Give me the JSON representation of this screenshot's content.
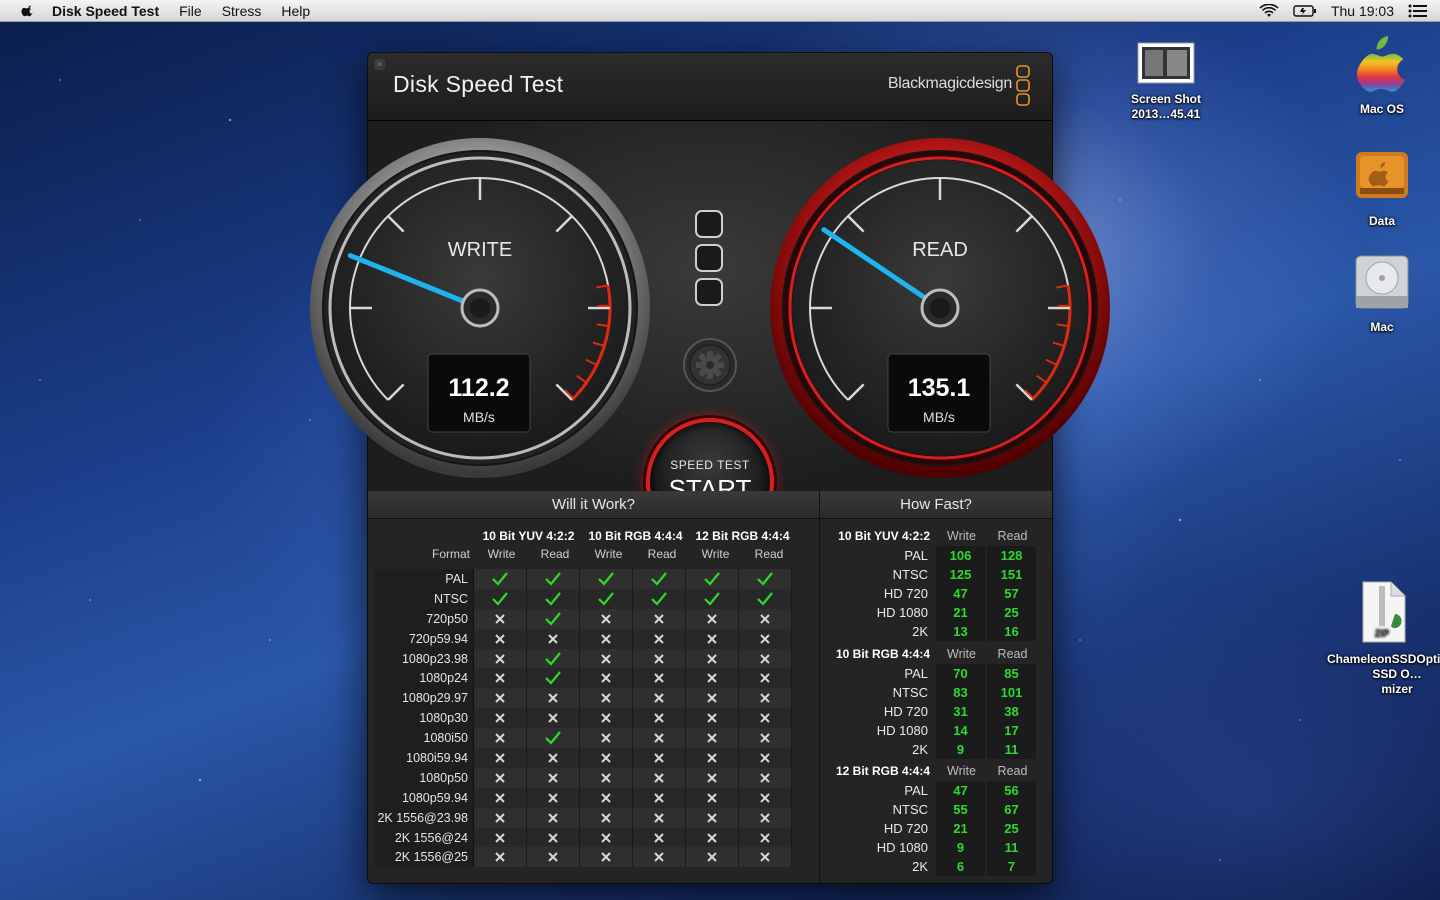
{
  "menubar": {
    "app_name": "Disk Speed Test",
    "menus": [
      "File",
      "Stress",
      "Help"
    ],
    "clock": "Thu 19:03"
  },
  "desktop_icons": [
    {
      "label": "Screen Shot 2013…45.41",
      "icon": "screenshot-file-icon"
    },
    {
      "label": "Mac OS",
      "icon": "apple-logo-drive-icon"
    },
    {
      "label": "Data",
      "icon": "external-drive-icon"
    },
    {
      "label": "Mac",
      "icon": "hard-drive-icon"
    },
    {
      "label": "ChameleonSSDOptimizer.zip",
      "overlap_label": "SSD O…mizer",
      "icon": "zip-file-icon"
    }
  ],
  "window": {
    "title": "Disk Speed Test",
    "brand": "Blackmagicdesign"
  },
  "gauges": {
    "write": {
      "label": "WRITE",
      "value": "112.2",
      "unit": "MB/s"
    },
    "read": {
      "label": "READ",
      "value": "135.1",
      "unit": "MB/s"
    }
  },
  "start_button": {
    "small": "SPEED TEST",
    "big": "START"
  },
  "will_it_work": {
    "title": "Will it Work?",
    "format_header": "Format",
    "groups": [
      "10 Bit YUV 4:2:2",
      "10 Bit RGB 4:4:4",
      "12 Bit RGB 4:4:4"
    ],
    "subcols": [
      "Write",
      "Read"
    ],
    "rows": [
      {
        "format": "PAL",
        "cells": [
          1,
          1,
          1,
          1,
          1,
          1
        ]
      },
      {
        "format": "NTSC",
        "cells": [
          1,
          1,
          1,
          1,
          1,
          1
        ]
      },
      {
        "format": "720p50",
        "cells": [
          0,
          1,
          0,
          0,
          0,
          0
        ]
      },
      {
        "format": "720p59.94",
        "cells": [
          0,
          0,
          0,
          0,
          0,
          0
        ]
      },
      {
        "format": "1080p23.98",
        "cells": [
          0,
          1,
          0,
          0,
          0,
          0
        ]
      },
      {
        "format": "1080p24",
        "cells": [
          0,
          1,
          0,
          0,
          0,
          0
        ]
      },
      {
        "format": "1080p29.97",
        "cells": [
          0,
          0,
          0,
          0,
          0,
          0
        ]
      },
      {
        "format": "1080p30",
        "cells": [
          0,
          0,
          0,
          0,
          0,
          0
        ]
      },
      {
        "format": "1080i50",
        "cells": [
          0,
          1,
          0,
          0,
          0,
          0
        ]
      },
      {
        "format": "1080i59.94",
        "cells": [
          0,
          0,
          0,
          0,
          0,
          0
        ]
      },
      {
        "format": "1080p50",
        "cells": [
          0,
          0,
          0,
          0,
          0,
          0
        ]
      },
      {
        "format": "1080p59.94",
        "cells": [
          0,
          0,
          0,
          0,
          0,
          0
        ]
      },
      {
        "format": "2K 1556@23.98",
        "cells": [
          0,
          0,
          0,
          0,
          0,
          0
        ]
      },
      {
        "format": "2K 1556@24",
        "cells": [
          0,
          0,
          0,
          0,
          0,
          0
        ]
      },
      {
        "format": "2K 1556@25",
        "cells": [
          0,
          0,
          0,
          0,
          0,
          0
        ]
      }
    ]
  },
  "how_fast": {
    "title": "How Fast?",
    "sections": [
      {
        "title": "10 Bit YUV 4:2:2",
        "write": "Write",
        "read": "Read",
        "rows": [
          [
            "PAL",
            "106",
            "128"
          ],
          [
            "NTSC",
            "125",
            "151"
          ],
          [
            "HD 720",
            "47",
            "57"
          ],
          [
            "HD 1080",
            "21",
            "25"
          ],
          [
            "2K",
            "13",
            "16"
          ]
        ]
      },
      {
        "title": "10 Bit RGB 4:4:4",
        "write": "Write",
        "read": "Read",
        "rows": [
          [
            "PAL",
            "70",
            "85"
          ],
          [
            "NTSC",
            "83",
            "101"
          ],
          [
            "HD 720",
            "31",
            "38"
          ],
          [
            "HD 1080",
            "14",
            "17"
          ],
          [
            "2K",
            "9",
            "11"
          ]
        ]
      },
      {
        "title": "12 Bit RGB 4:4:4",
        "write": "Write",
        "read": "Read",
        "rows": [
          [
            "PAL",
            "47",
            "56"
          ],
          [
            "NTSC",
            "55",
            "67"
          ],
          [
            "HD 720",
            "21",
            "25"
          ],
          [
            "HD 1080",
            "9",
            "11"
          ],
          [
            "2K",
            "6",
            "7"
          ]
        ]
      }
    ]
  },
  "colors": {
    "accent_red": "#d42020",
    "needle_blue": "#1eb4f0",
    "ok_green": "#2bdb2b"
  }
}
